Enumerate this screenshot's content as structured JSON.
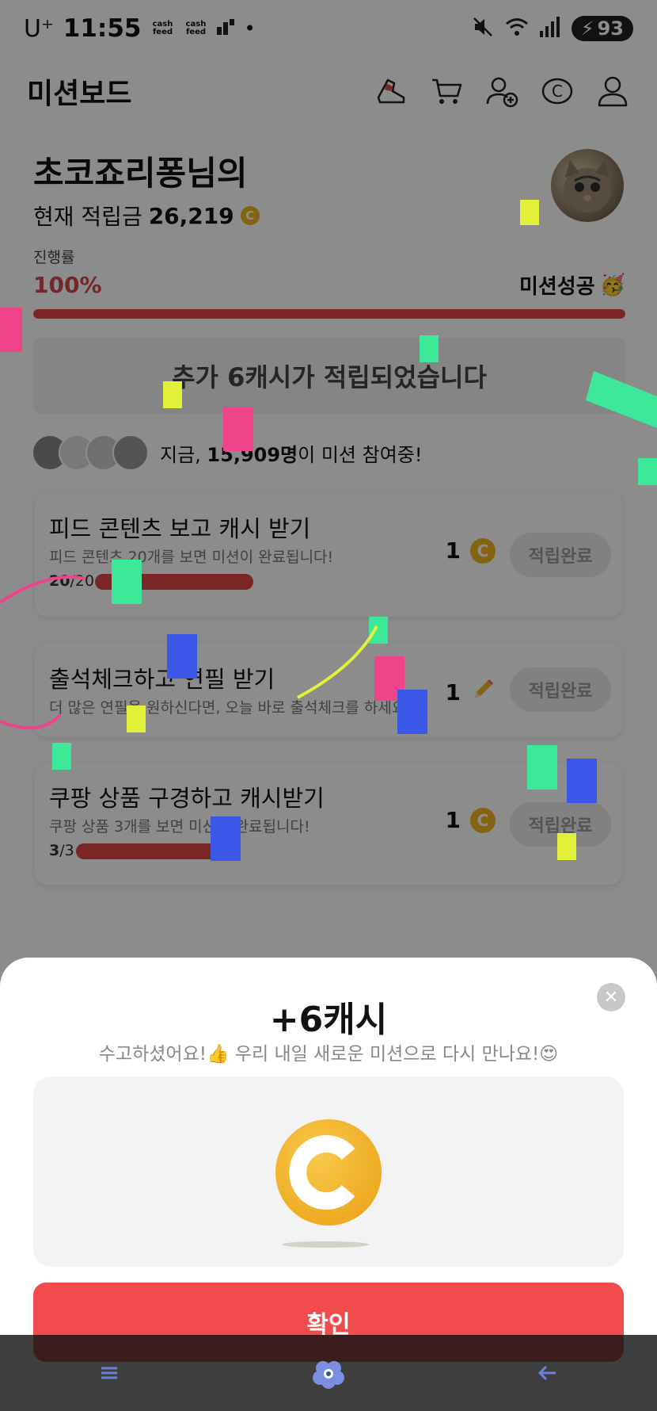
{
  "status_bar": {
    "carrier": "U⁺",
    "time": "11:55",
    "badge1": "cash feed",
    "badge2": "cash feed",
    "dot": "•",
    "battery": "93"
  },
  "header": {
    "title": "미션보드",
    "icons": [
      "shoe-icon",
      "cart-icon",
      "add-friend-icon",
      "cash-icon",
      "profile-icon"
    ]
  },
  "profile": {
    "nickname": "초코죠리퐁님의",
    "balance_label": "현재 적립금",
    "balance_value": "26,219",
    "coin_symbol": "C"
  },
  "progress": {
    "label": "진행률",
    "value_text": "100%",
    "value": 1.0,
    "status": "미션성공",
    "status_emoji": "🥳"
  },
  "notice": {
    "text": "추가 6캐시가 적립되었습니다"
  },
  "participants": {
    "prefix": "지금, ",
    "count": "15,909명",
    "suffix": "이 미션 참여중!"
  },
  "missions": [
    {
      "title": "피드 콘텐츠 보고 캐시 받기",
      "desc": "피드 콘텐츠 20개를 보면 미션이 완료됩니다!",
      "done": "20",
      "total": "/20",
      "progress": 1.0,
      "reward": "1",
      "reward_icon": "coin-icon",
      "button": "적립완료"
    },
    {
      "title": "출석체크하고 연필 받기",
      "desc": "더 많은 연필을 원하신다면, 오늘 바로 출석체크를 하세요!",
      "reward": "1",
      "reward_icon": "pencil-icon",
      "button": "적립완료"
    },
    {
      "title": "쿠팡 상품 구경하고 캐시받기",
      "desc": "쿠팡 상품 3개를 보면 미션이 완료됩니다!",
      "done": "3",
      "total": "/3",
      "progress": 1.0,
      "reward": "1",
      "reward_icon": "coin-icon",
      "button": "적립완료"
    }
  ],
  "sheet": {
    "title": "+6캐시",
    "subtitle": "수고하셨어요!👍 우리 내일 새로운 미션으로 다시 만나요!😍",
    "close": "✕",
    "confirm": "확인"
  },
  "navbar": {
    "items": [
      "menu-icon",
      "home-flower-icon",
      "back-icon"
    ]
  },
  "colors": {
    "accent": "#f14b4b",
    "progress": "#e04545",
    "coin": "#f0b623"
  }
}
